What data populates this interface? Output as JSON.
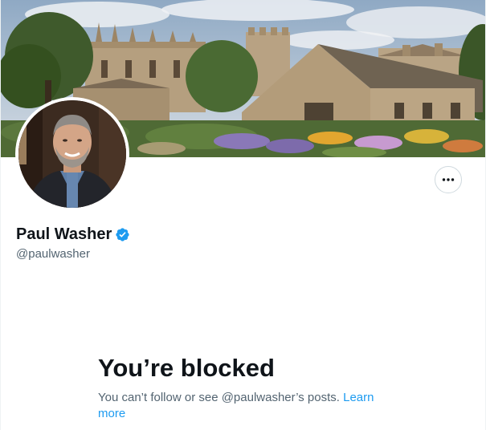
{
  "profile": {
    "display_name": "Paul Washer",
    "handle": "@paulwasher",
    "verified": true,
    "verified_color": "#1d9bf0"
  },
  "actions": {
    "more_icon": "more-horizontal-icon"
  },
  "blocked": {
    "title": "You’re blocked",
    "body": "You can’t follow or see @paulwasher’s posts.",
    "link_label": "Learn more",
    "link_color": "#1d9bf0"
  }
}
